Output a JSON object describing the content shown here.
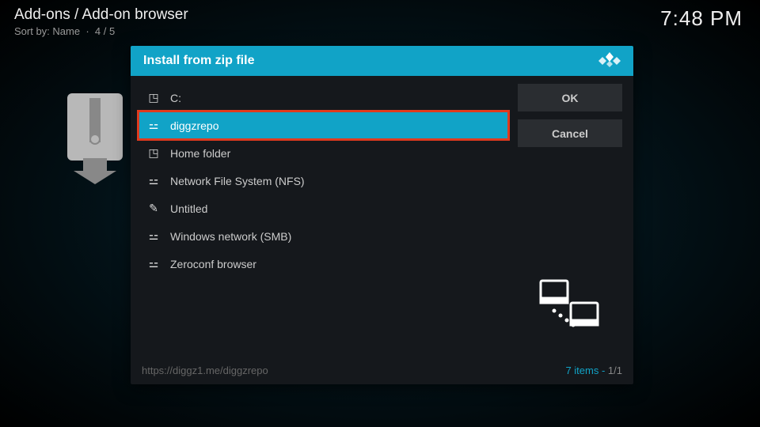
{
  "header": {
    "breadcrumb": "Add-ons / Add-on browser",
    "sort_label": "Sort by:",
    "sort_value": "Name",
    "position": "4 / 5"
  },
  "clock": "7:48 PM",
  "dialog": {
    "title": "Install from zip file",
    "buttons": {
      "ok": "OK",
      "cancel": "Cancel"
    },
    "items": [
      {
        "icon": "drive",
        "label": "C:"
      },
      {
        "icon": "net",
        "label": "diggzrepo"
      },
      {
        "icon": "drive",
        "label": "Home folder"
      },
      {
        "icon": "net",
        "label": "Network File System (NFS)"
      },
      {
        "icon": "pen",
        "label": "Untitled"
      },
      {
        "icon": "net",
        "label": "Windows network (SMB)"
      },
      {
        "icon": "net",
        "label": "Zeroconf browser"
      }
    ],
    "footer_path": "https://diggz1.me/diggzrepo",
    "footer_items": "7 items",
    "footer_page": "1/1"
  }
}
